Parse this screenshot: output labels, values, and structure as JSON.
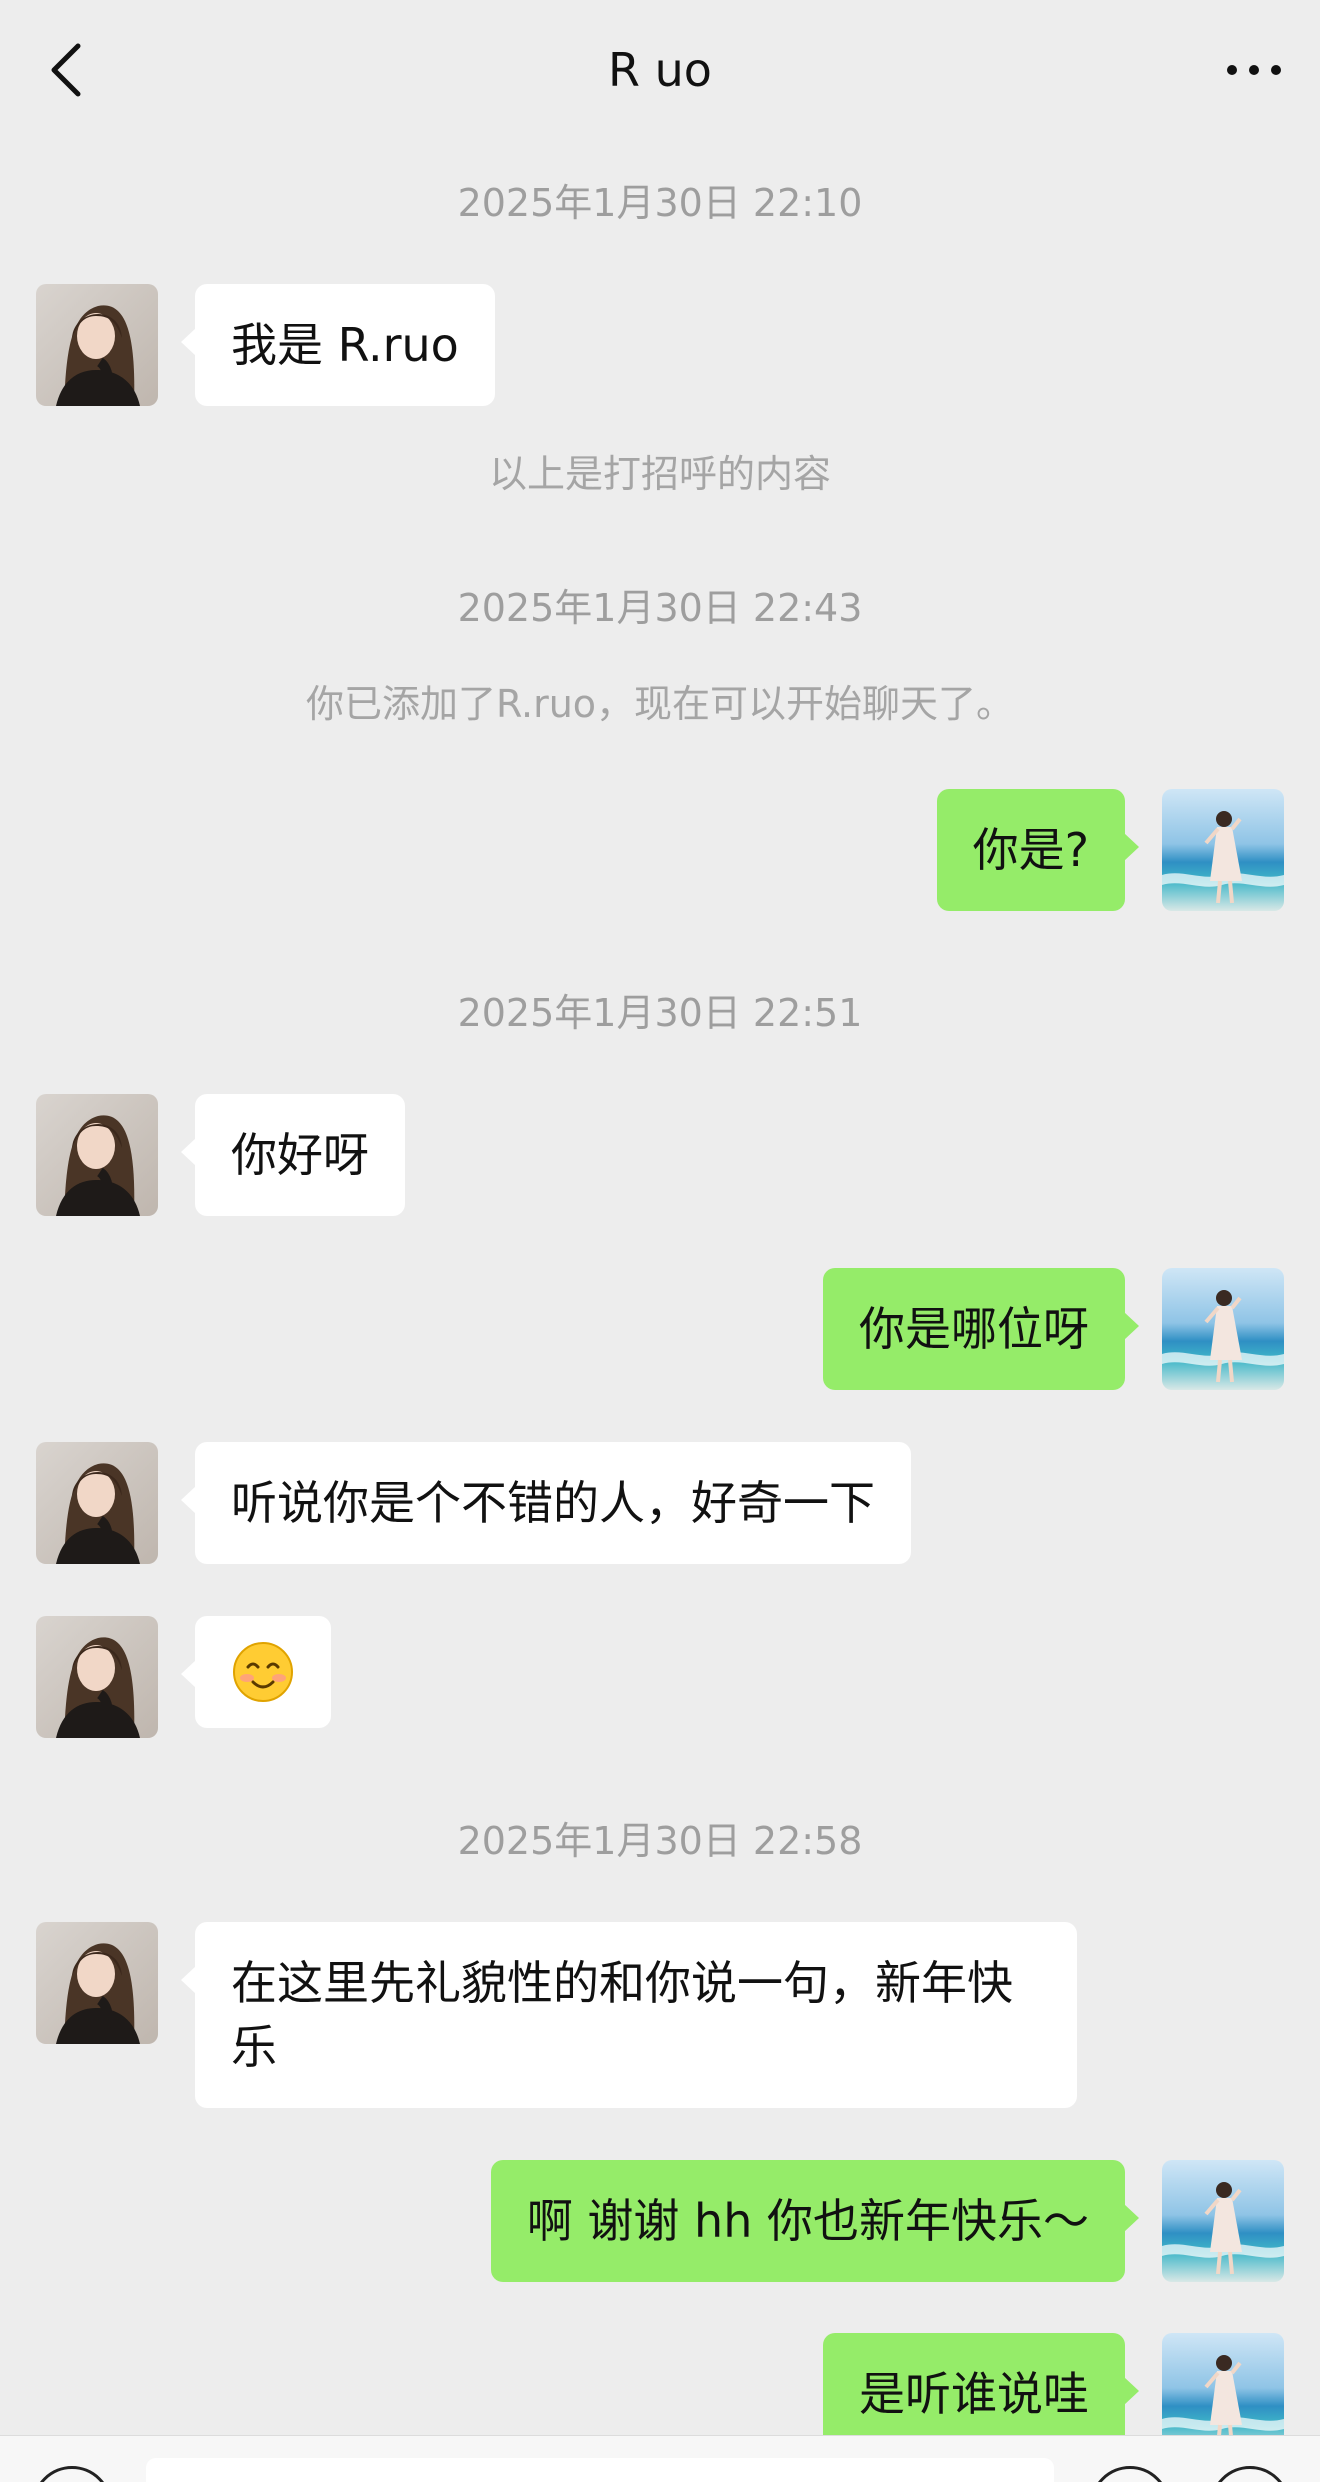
{
  "nav": {
    "title": "R uo",
    "back_icon": "chevron-left-icon",
    "more_icon": "more-dots-icon"
  },
  "colors": {
    "background": "#ededed",
    "incoming_bubble": "#ffffff",
    "outgoing_bubble": "#95ec69",
    "system_text": "#9e9e9e"
  },
  "timestamps": [
    "2025年1月30日 22:10",
    "2025年1月30日 22:43",
    "2025年1月30日 22:51",
    "2025年1月30日 22:58"
  ],
  "system_messages": [
    "以上是打招呼的内容",
    "你已添加了R.ruo，现在可以开始聊天了。"
  ],
  "messages": [
    {
      "from": "contact",
      "text": "我是 R.ruo"
    },
    {
      "from": "me",
      "text": "你是?"
    },
    {
      "from": "contact",
      "text": "你好呀"
    },
    {
      "from": "me",
      "text": "你是哪位呀"
    },
    {
      "from": "contact",
      "text": "听说你是个不错的人，好奇一下"
    },
    {
      "from": "contact",
      "emoji": "smiling-face-emoji"
    },
    {
      "from": "contact",
      "text": "在这里先礼貌性的和你说一句，新年快乐"
    },
    {
      "from": "me",
      "text": "啊 谢谢 hh 你也新年快乐～"
    },
    {
      "from": "me",
      "text": "是听谁说哇"
    }
  ],
  "input_bar": {
    "voice_icon": "voice-icon",
    "emoji_icon": "emoji-icon",
    "plus_icon": "plus-icon"
  }
}
